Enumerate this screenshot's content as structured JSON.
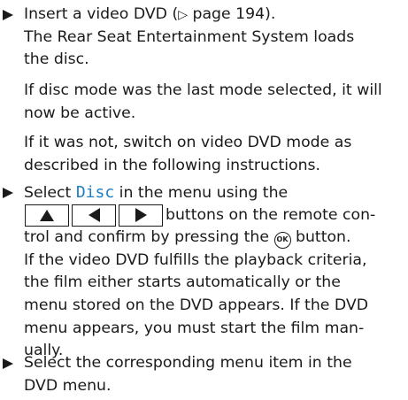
{
  "step1": {
    "l1_a": "Insert a video DVD (",
    "page_ref_glyph": "▷",
    "l1_b": " page 194).",
    "l2": "The Rear Seat Entertainment System loads",
    "l3": "the disc."
  },
  "para1": {
    "l1": "If disc mode was the last mode selected, it will",
    "l2": "now be active."
  },
  "para2": {
    "l1": "If it was not, switch on video DVD mode as",
    "l2": "described in the following instructions."
  },
  "step2": {
    "l1_a": "Select ",
    "l1_hl": "Disc",
    "l1_b": " in the menu using the",
    "keys_text": " buttons on the remote con-",
    "l3_a": "trol and confirm by pressing the ",
    "ok_label": "OK",
    "l3_b": " button.",
    "l4": "If the video DVD fulfills the playback criteria,",
    "l5": "the film either starts automatically or the",
    "l6": "menu stored on the DVD appears. If the DVD",
    "l7": "menu appears, you must start the film man-",
    "l8": "ually."
  },
  "step3": {
    "l1": "Select the corresponding menu item in the",
    "l2": "DVD menu."
  }
}
